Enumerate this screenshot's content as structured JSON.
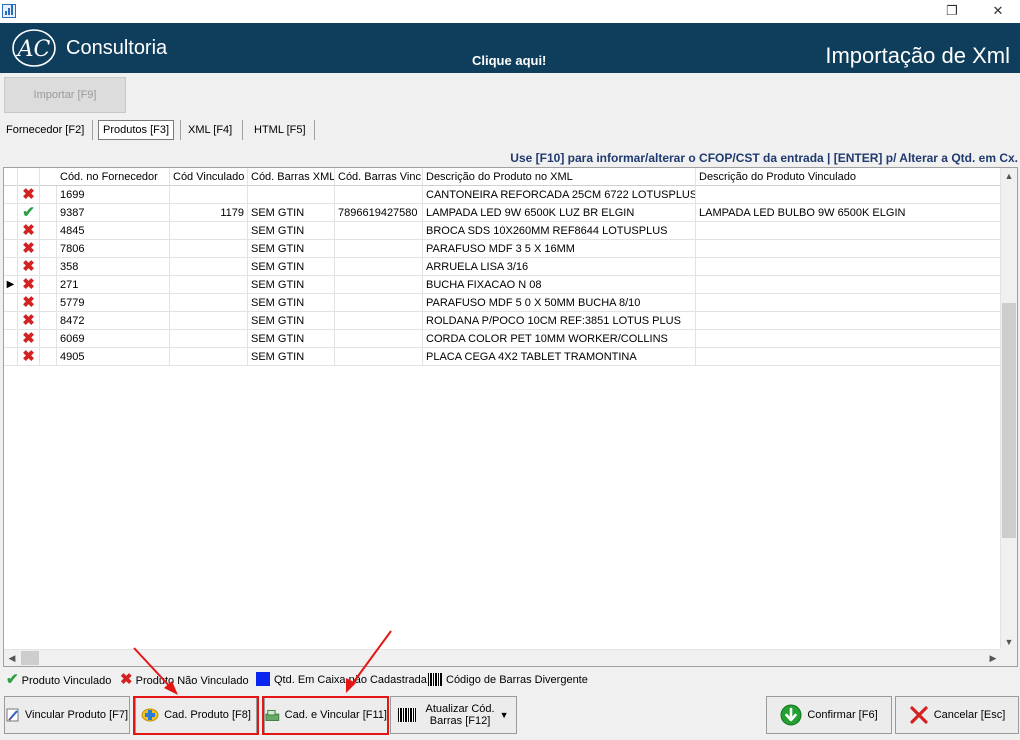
{
  "window": {
    "controls": {
      "restore": "❐",
      "close": "✕"
    }
  },
  "header": {
    "logo_mark": "AC",
    "logo_text": "Consultoria",
    "click_here": "Clique aqui!",
    "title": "Importação de Xml",
    "bg_color": "#0f3d5c"
  },
  "import_button": {
    "label": "Importar [F9]",
    "enabled": false
  },
  "tabs": [
    {
      "label": "Fornecedor [F2]",
      "active": false
    },
    {
      "label": "Produtos [F3]",
      "active": true
    },
    {
      "label": "XML [F4]",
      "active": false
    },
    {
      "label": "HTML [F5]",
      "active": false
    }
  ],
  "hint": "Use [F10] para informar/alterar o CFOP/CST da entrada | [ENTER] p/ Alterar a Qtd. em Cx.",
  "grid": {
    "columns": [
      "",
      "",
      "Cód. no Fornecedor",
      "Cód Vinculado",
      "Cód. Barras XML",
      "Cód. Barras Vinc.",
      "Descrição do Produto no XML",
      "Descrição do Produto Vinculado"
    ],
    "rows": [
      {
        "current": false,
        "status": "nao-vinculado",
        "cod_fornecedor": "1699",
        "cod_vinculado": "",
        "barras_xml": "",
        "barras_vinc": "",
        "desc_xml": "CANTONEIRA REFORCADA 25CM 6722 LOTUSPLUS",
        "desc_vinc": ""
      },
      {
        "current": false,
        "status": "vinculado",
        "cod_fornecedor": "9387",
        "cod_vinculado": "1179",
        "barras_xml": "SEM GTIN",
        "barras_vinc": "7896619427580",
        "desc_xml": "LAMPADA LED 9W 6500K LUZ BR ELGIN",
        "desc_vinc": "LAMPADA LED BULBO 9W 6500K ELGIN"
      },
      {
        "current": false,
        "status": "nao-vinculado",
        "cod_fornecedor": "4845",
        "cod_vinculado": "",
        "barras_xml": "SEM GTIN",
        "barras_vinc": "",
        "desc_xml": "BROCA SDS 10X260MM REF8644 LOTUSPLUS",
        "desc_vinc": ""
      },
      {
        "current": false,
        "status": "nao-vinculado",
        "cod_fornecedor": "7806",
        "cod_vinculado": "",
        "barras_xml": "SEM GTIN",
        "barras_vinc": "",
        "desc_xml": "PARAFUSO MDF 3 5 X 16MM",
        "desc_vinc": ""
      },
      {
        "current": false,
        "status": "nao-vinculado",
        "cod_fornecedor": "358",
        "cod_vinculado": "",
        "barras_xml": "SEM GTIN",
        "barras_vinc": "",
        "desc_xml": "ARRUELA LISA 3/16",
        "desc_vinc": ""
      },
      {
        "current": true,
        "status": "nao-vinculado",
        "cod_fornecedor": "271",
        "cod_vinculado": "",
        "barras_xml": "SEM GTIN",
        "barras_vinc": "",
        "desc_xml": "BUCHA FIXACAO N 08",
        "desc_vinc": ""
      },
      {
        "current": false,
        "status": "nao-vinculado",
        "cod_fornecedor": "5779",
        "cod_vinculado": "",
        "barras_xml": "SEM GTIN",
        "barras_vinc": "",
        "desc_xml": "PARAFUSO MDF 5 0 X 50MM BUCHA 8/10",
        "desc_vinc": ""
      },
      {
        "current": false,
        "status": "nao-vinculado",
        "cod_fornecedor": "8472",
        "cod_vinculado": "",
        "barras_xml": "SEM GTIN",
        "barras_vinc": "",
        "desc_xml": "ROLDANA P/POCO 10CM REF:3851 LOTUS PLUS",
        "desc_vinc": ""
      },
      {
        "current": false,
        "status": "nao-vinculado",
        "cod_fornecedor": "6069",
        "cod_vinculado": "",
        "barras_xml": "SEM GTIN",
        "barras_vinc": "",
        "desc_xml": "CORDA COLOR PET 10MM WORKER/COLLINS",
        "desc_vinc": ""
      },
      {
        "current": false,
        "status": "nao-vinculado",
        "cod_fornecedor": "4905",
        "cod_vinculado": "",
        "barras_xml": "SEM GTIN",
        "barras_vinc": "",
        "desc_xml": "PLACA CEGA 4X2 TABLET TRAMONTINA",
        "desc_vinc": ""
      }
    ]
  },
  "legend": {
    "vinculado": "Produto Vinculado",
    "nao_vinculado": "Produto Não Vinculado",
    "qtd_caixa": "Qtd. Em Caixa não Cadastrada",
    "barras_divergente": "Código de Barras Divergente"
  },
  "buttons": {
    "vincular": "Vincular Produto [F7]",
    "cad_produto": "Cad. Produto [F8]",
    "cad_vincular": "Cad. e Vincular [F11]",
    "atualizar_line1": "Atualizar Cód.",
    "atualizar_line2": "Barras [F12]",
    "confirmar": "Confirmar [F6]",
    "cancelar": "Cancelar [Esc]"
  },
  "colors": {
    "red_x": "#d42222",
    "green_check": "#2ea043",
    "highlight": "#e41515",
    "blue_square": "#0a24f0"
  }
}
